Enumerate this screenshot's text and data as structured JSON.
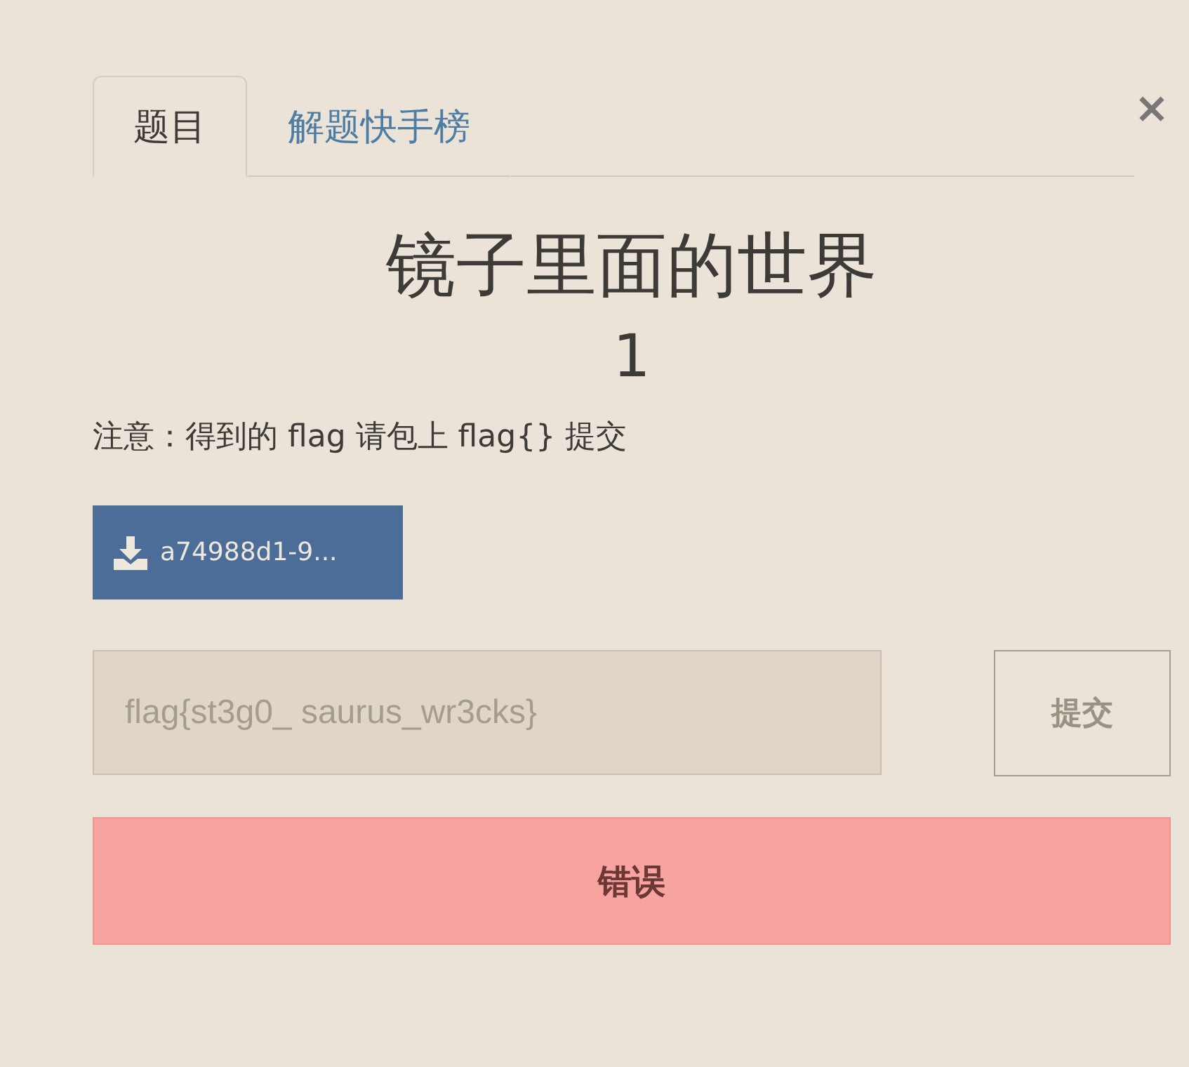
{
  "tabs": [
    {
      "label": "题目",
      "selected": true
    },
    {
      "label": "解题快手榜",
      "selected": false
    }
  ],
  "close": "×",
  "challenge": {
    "title": "镜子里面的世界",
    "points": "1",
    "note": "注意：得到的 flag 请包上 flag{} 提交",
    "file": "a74988d1-9..."
  },
  "answer": {
    "value": "flag{st3g0_ saurus_wr3cks}",
    "submit": "提交"
  },
  "result": {
    "kind": "error",
    "message": "错误"
  }
}
